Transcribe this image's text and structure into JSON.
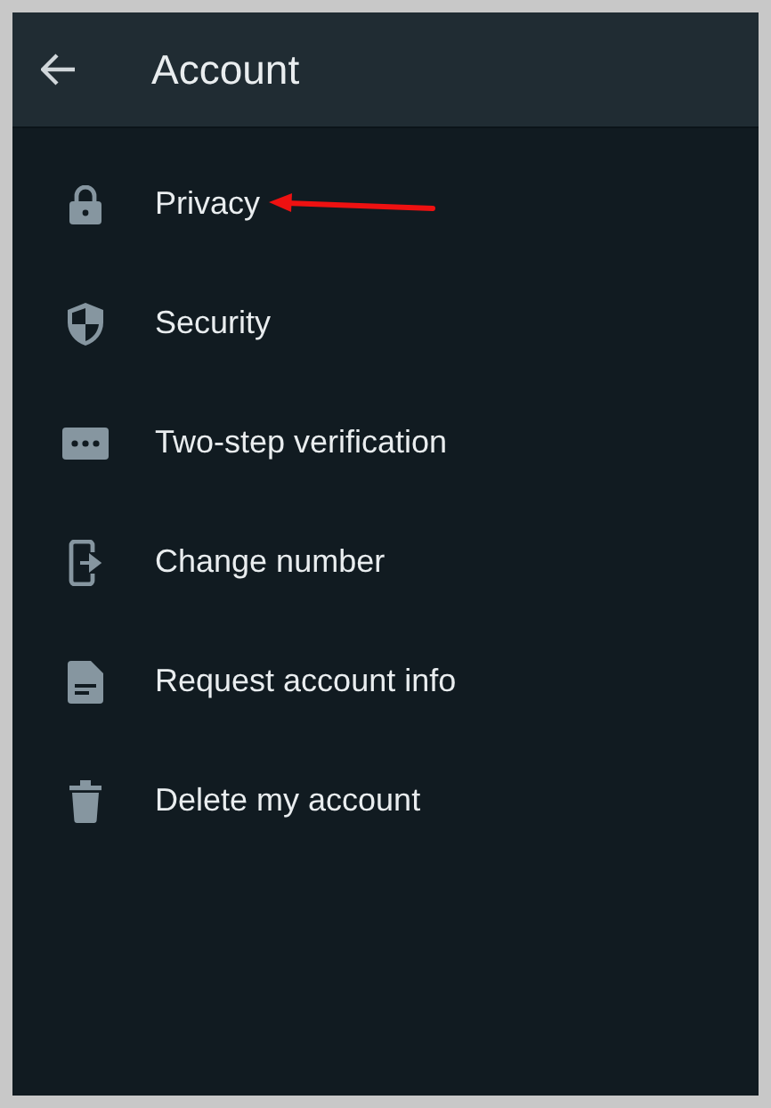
{
  "header": {
    "title": "Account"
  },
  "items": [
    {
      "label": "Privacy"
    },
    {
      "label": "Security"
    },
    {
      "label": "Two-step verification"
    },
    {
      "label": "Change number"
    },
    {
      "label": "Request account info"
    },
    {
      "label": "Delete my account"
    }
  ]
}
